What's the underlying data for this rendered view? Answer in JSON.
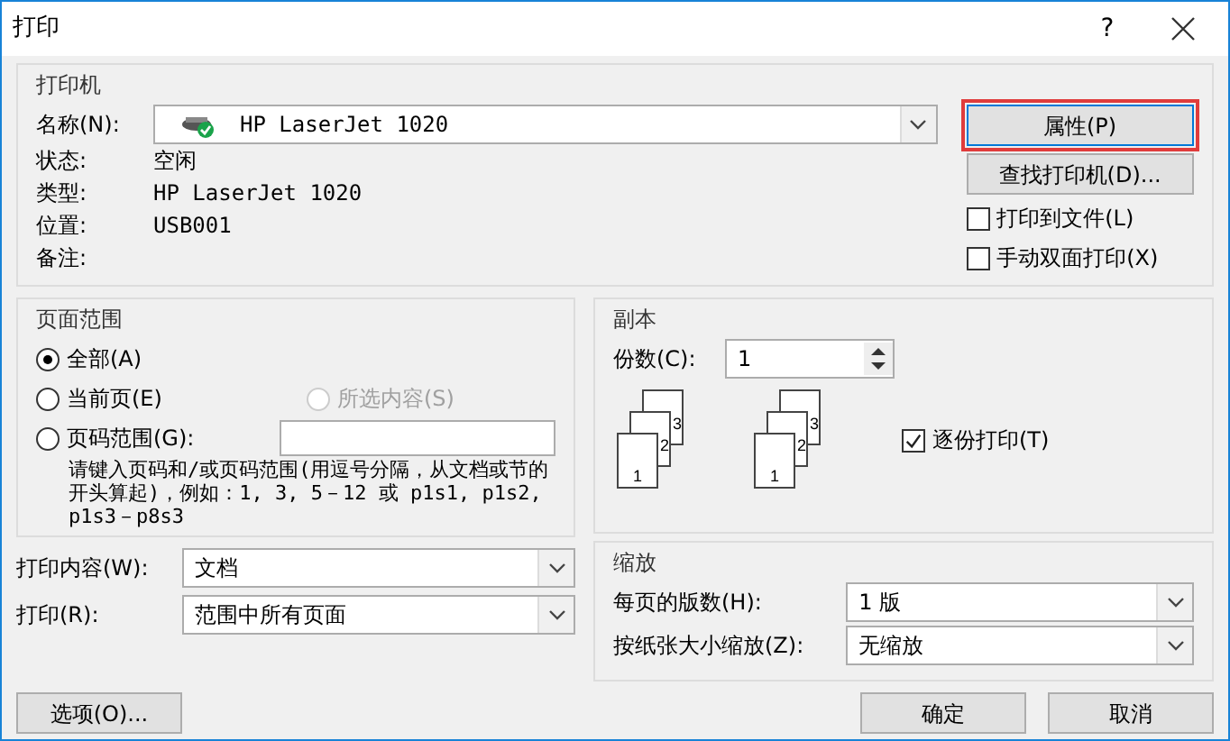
{
  "window": {
    "title": "打印",
    "help": "?"
  },
  "printer": {
    "title": "打印机",
    "name_label": "名称(N):",
    "name_value": "HP LaserJet 1020",
    "info": [
      {
        "label": "状态:",
        "value": "空闲"
      },
      {
        "label": "类型:",
        "value": "HP LaserJet 1020"
      },
      {
        "label": "位置:",
        "value": "USB001"
      },
      {
        "label": "备注:"
      }
    ],
    "buttons": [
      {
        "label": "属性(P)",
        "highlighted": true
      },
      {
        "label": "查找打印机(D)...",
        "highlighted": false
      }
    ],
    "checkboxes": [
      {
        "label": "打印到文件(L)",
        "checked": false
      },
      {
        "label": "手动双面打印(X)",
        "checked": false
      }
    ]
  },
  "page_range": {
    "title": "页面范围",
    "options": [
      {
        "label": "全部(A)",
        "selected": true,
        "disabled": false
      },
      {
        "label": "当前页(E)",
        "selected": false,
        "disabled": false
      },
      {
        "label": "所选内容(S)",
        "selected": false,
        "disabled": true
      },
      {
        "label": "页码范围(G):",
        "selected": false,
        "disabled": false
      }
    ],
    "hint": "请键入页码和/或页码范围(用逗号分隔，从文档或节的开头算起)，例如：1, 3, 5－12 或 p1s1, p1s2, p1s3－p8s3"
  },
  "copies": {
    "title": "副本",
    "count_label": "份数(C):",
    "count_value": "1",
    "stacks": [
      [
        "3",
        "2",
        "1"
      ],
      [
        "3",
        "2",
        "1"
      ]
    ],
    "collate": {
      "label": "逐份打印(T)",
      "checked": true
    }
  },
  "print_what": [
    {
      "label": "打印内容(W):",
      "value": "文档"
    },
    {
      "label": "打印(R):",
      "value": "范围中所有页面"
    }
  ],
  "zoom": {
    "title": "缩放",
    "rows": [
      {
        "label": "每页的版数(H):",
        "value": "1 版"
      },
      {
        "label": "按纸张大小缩放(Z):",
        "value": "无缩放"
      }
    ]
  },
  "footer": {
    "options_button": "选项(O)...",
    "ok_button": "确定",
    "cancel_button": "取消"
  }
}
